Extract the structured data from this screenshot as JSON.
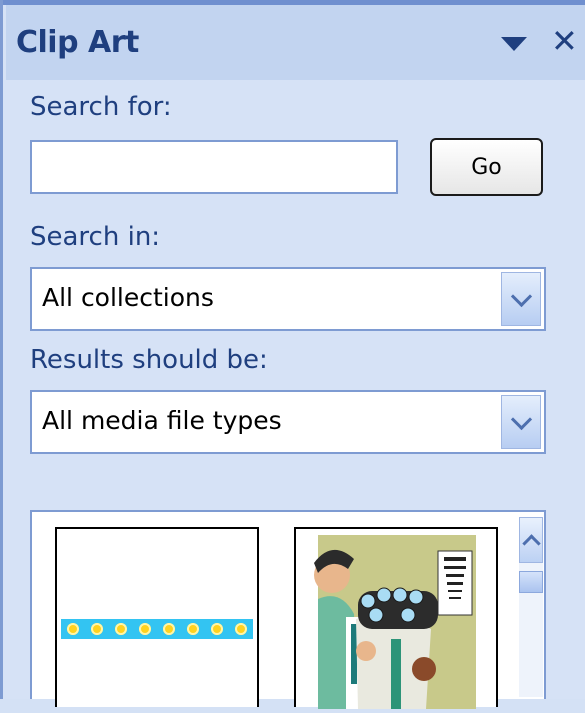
{
  "pane": {
    "title": "Clip Art",
    "menu_icon": "triangle-down-icon",
    "close_icon": "close-icon"
  },
  "search": {
    "label": "Search for:",
    "value": "",
    "go_label": "Go"
  },
  "search_in": {
    "label": "Search in:",
    "selected": "All collections"
  },
  "results_type": {
    "label": "Results should be:",
    "selected": "All media file types"
  },
  "results": {
    "items": [
      {
        "icon": "border-light-bulbs-clip"
      },
      {
        "icon": "optometrist-eye-exam-clip"
      }
    ]
  },
  "colors": {
    "pane_bg": "#d6e2f6",
    "header_bg": "#c2d4f0",
    "title_text": "#1f3f7f",
    "border": "#7e9bd2"
  }
}
